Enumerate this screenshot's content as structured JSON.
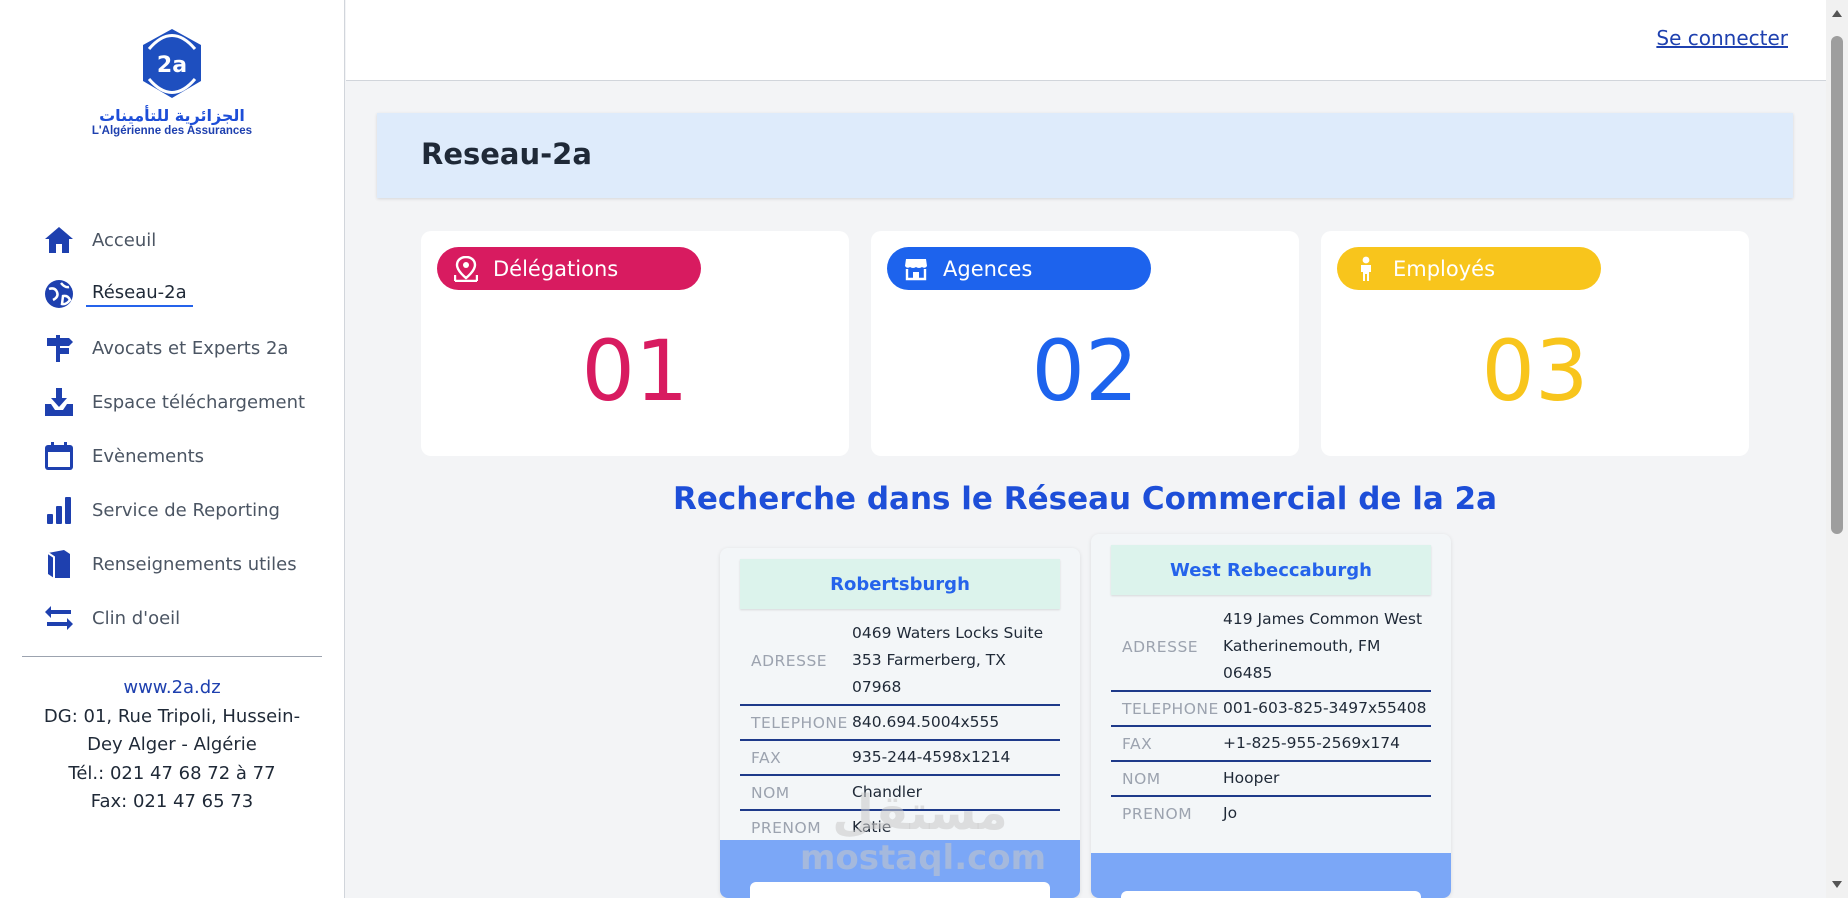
{
  "sidebar": {
    "logo": {
      "badge": "2a",
      "arabic": "الجزائرية للتأمينات",
      "french": "L'Algérienne des Assurances"
    },
    "items": [
      {
        "label": "Acceuil",
        "icon": "home-icon"
      },
      {
        "label": "Réseau-2a",
        "icon": "globe-icon",
        "active": true
      },
      {
        "label": "Avocats et Experts 2a",
        "icon": "signpost-icon"
      },
      {
        "label": "Espace téléchargement",
        "icon": "download-icon"
      },
      {
        "label": "Evènements",
        "icon": "calendar-icon"
      },
      {
        "label": "Service de Reporting",
        "icon": "bar-chart-icon"
      },
      {
        "label": "Renseignements utiles",
        "icon": "book-icon"
      },
      {
        "label": "Clin d'oeil",
        "icon": "arrows-exchange-icon"
      }
    ],
    "contact": {
      "website": "www.2a.dz",
      "address_line1": "DG: 01, Rue Tripoli, Hussein-",
      "address_line2": "Dey Alger - Algérie",
      "phone": "Tél.: 021 47 68 72 à 77",
      "fax": "Fax: 021 47 65 73"
    }
  },
  "topbar": {
    "login_label": "Se connecter"
  },
  "page": {
    "title": "Reseau-2a"
  },
  "stats": [
    {
      "label": "Délégations",
      "value": "01",
      "color": "#d81b60",
      "icon": "map-pin-icon"
    },
    {
      "label": "Agences",
      "value": "02",
      "color": "#1d63ed",
      "icon": "storefront-icon"
    },
    {
      "label": "Employés",
      "value": "03",
      "color": "#f8c51c",
      "icon": "person-icon"
    }
  ],
  "search": {
    "title": "Recherche dans le Réseau Commercial de la 2a"
  },
  "results": [
    {
      "city": "Robertsburgh",
      "fields": [
        {
          "key": "ADRESSE",
          "value": "0469 Waters Locks Suite 353 Farmerberg, TX 07968"
        },
        {
          "key": "TELEPHONE",
          "value": "840.694.5004x555"
        },
        {
          "key": "FAX",
          "value": "935-244-4598x1214"
        },
        {
          "key": "NOM",
          "value": "Chandler"
        },
        {
          "key": "PRENOM",
          "value": "Katie"
        }
      ]
    },
    {
      "city": "West Rebeccaburgh",
      "fields": [
        {
          "key": "ADRESSE",
          "value": "419 James Common West Katherinemouth, FM 06485"
        },
        {
          "key": "TELEPHONE",
          "value": "001-603-825-3497x55408"
        },
        {
          "key": "FAX",
          "value": "+1-825-955-2569x174"
        },
        {
          "key": "NOM",
          "value": "Hooper"
        },
        {
          "key": "PRENOM",
          "value": "Jo"
        }
      ]
    }
  ],
  "watermark": {
    "arabic": "مستقل",
    "latin": "mostaql.com"
  },
  "colors": {
    "accent": "#1d4ed8",
    "sidebar_icon": "#1e40af",
    "header_bg": "#deebfb"
  }
}
